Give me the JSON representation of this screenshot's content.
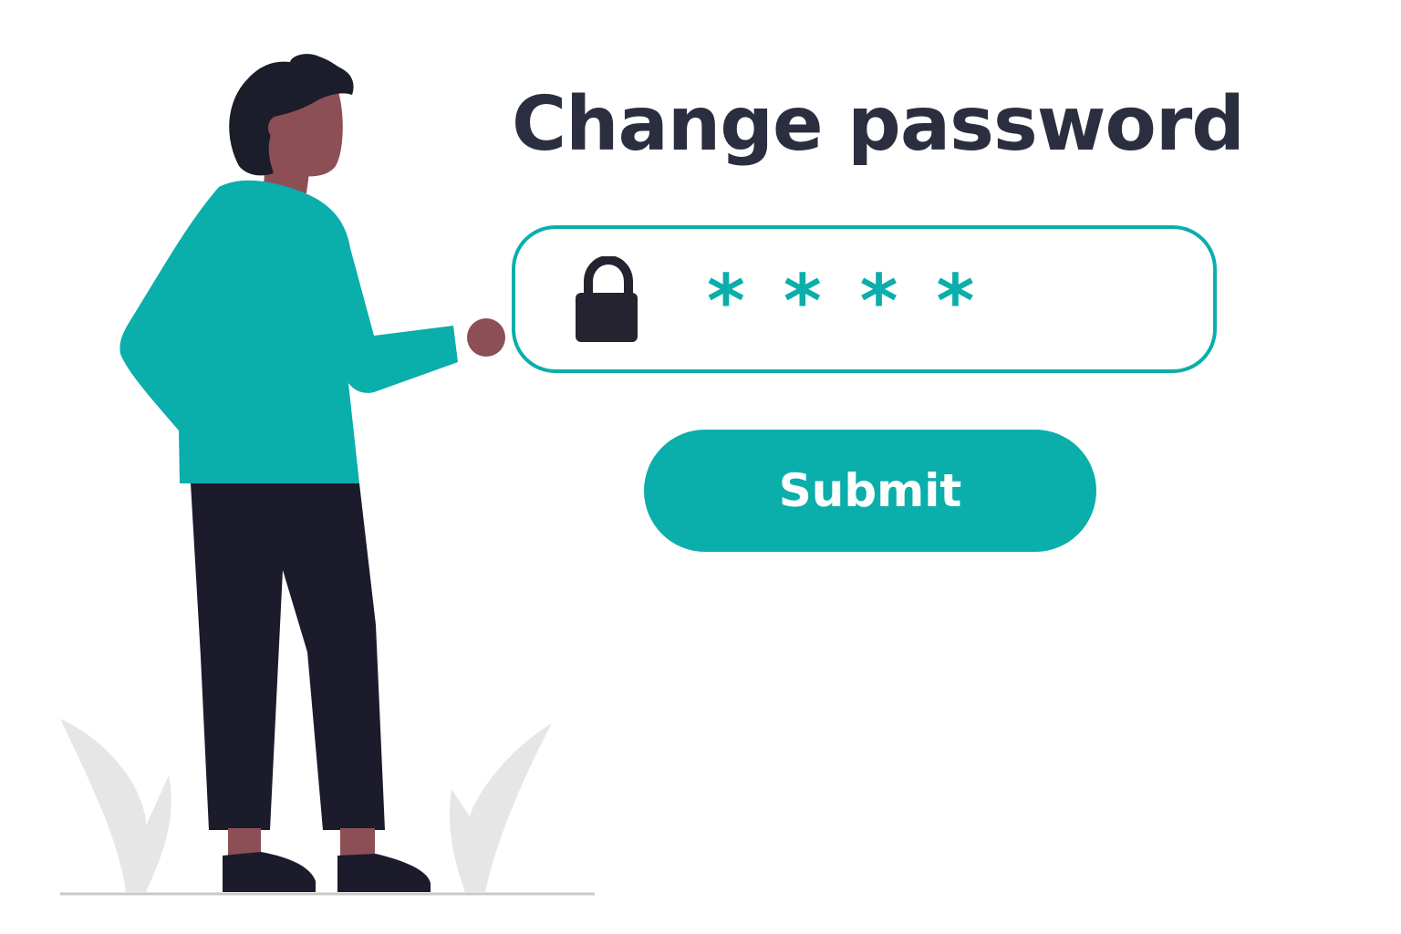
{
  "colors": {
    "accent": "#0aaeaa",
    "title_text": "#2b2e3f",
    "skin": "#8c4f56",
    "hair": "#1b1d2a",
    "pants": "#1c1b2c",
    "plant": "#e6e6e6",
    "ground": "#c8c8c8",
    "background": "#ffffff"
  },
  "page": {
    "title": "Change password"
  },
  "password_field": {
    "icon": "lock-icon",
    "masked_value": "****"
  },
  "submit": {
    "label": "Submit"
  },
  "illustration": {
    "subject": "person-pointing-at-password-field"
  }
}
